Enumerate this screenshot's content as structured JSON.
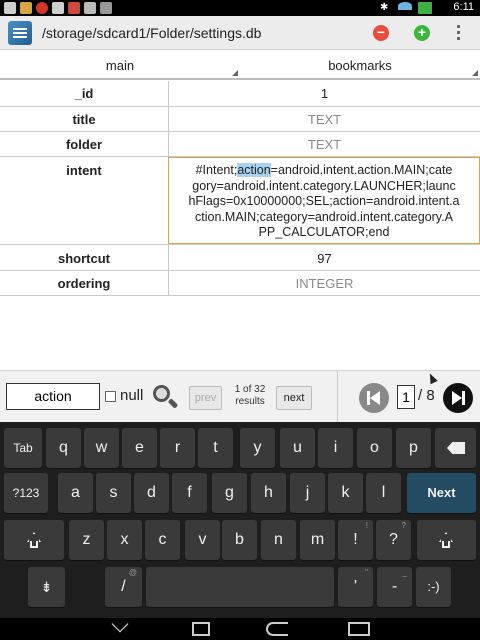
{
  "status_bar": {
    "time": "6:11"
  },
  "action_bar": {
    "path": "/storage/sdcard1/Folder/settings.db",
    "remove_icon": "minus-circle-icon",
    "add_icon": "plus-circle-icon",
    "menu_icon": "overflow-menu-icon"
  },
  "table_tabs": [
    "main",
    "bookmarks"
  ],
  "record": {
    "rows": [
      {
        "name": "_id",
        "value": "1"
      },
      {
        "name": "title",
        "value": "TEXT"
      },
      {
        "name": "folder",
        "value": "TEXT"
      },
      {
        "name": "intent",
        "pre": "#Intent;",
        "highlight": "action",
        "post": "=android.intent.action.MAIN;cate",
        "lines": [
          "gory=android.intent.category.LAUNCHER;launc",
          "hFlags=0x10000000;SEL;action=android.intent.a",
          "ction.MAIN;category=android.intent.category.A",
          "PP_CALCULATOR;end"
        ]
      },
      {
        "name": "shortcut",
        "value": "97"
      },
      {
        "name": "ordering",
        "value": "INTEGER"
      }
    ]
  },
  "search": {
    "query": "action",
    "null_label": "null",
    "prev_label": "prev",
    "next_label": "next",
    "results_count": "1 of 32",
    "results_label": "results"
  },
  "pagination": {
    "current": "1",
    "total": "/ 8"
  },
  "keyboard": {
    "row1": [
      "Tab",
      "q",
      "w",
      "e",
      "r",
      "t",
      "y",
      "u",
      "i",
      "o",
      "p"
    ],
    "row2": [
      "?123",
      "a",
      "s",
      "d",
      "f",
      "g",
      "h",
      "j",
      "k",
      "l",
      "Next"
    ],
    "row3": [
      "z",
      "x",
      "c",
      "v",
      "b",
      "n",
      "m",
      "!",
      "?"
    ],
    "row3_hints": [
      "",
      "",
      "",
      "",
      "",
      "",
      "",
      "!",
      "?"
    ],
    "row4": [
      "/",
      "'",
      "-",
      ":-)"
    ],
    "row4_hints": [
      "@",
      "\"",
      "_",
      ""
    ]
  }
}
